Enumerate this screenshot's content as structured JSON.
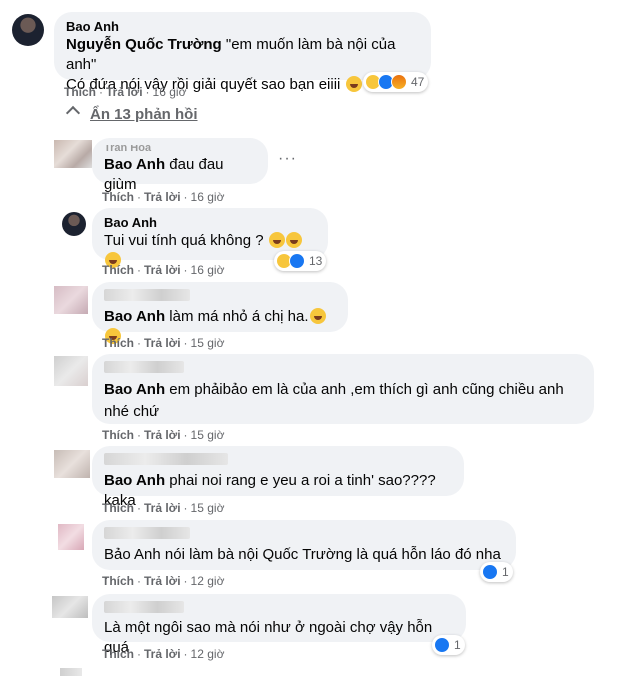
{
  "top_comment": {
    "author": "Bao Anh",
    "mention": "Nguyễn Quốc Trường",
    "line1_rest": " \"em muốn làm bà nội của anh\"",
    "line2": "Có đứa nói vậy rồi giải quyết sao bạn eiiii",
    "reaction_count": "47",
    "like": "Thích",
    "reply": "Trả lời",
    "time": "16 giờ"
  },
  "hide_replies": "Ẩn 13 phản hồi",
  "replies": [
    {
      "author": "Trần Hoà",
      "mention": "Bao Anh",
      "text": " đau đau giùm",
      "like": "Thích",
      "reply": "Trả lời",
      "time": "16 giờ"
    },
    {
      "author": "Bao Anh",
      "text": "Tui vui tính quá không ?",
      "reaction_count": "13",
      "like": "Thích",
      "reply": "Trả lời",
      "time": "16 giờ"
    },
    {
      "mention": "Bao Anh",
      "text": " làm má nhỏ á chị ha.",
      "like": "Thích",
      "reply": "Trả lời",
      "time": "15 giờ"
    },
    {
      "mention": "Bao Anh",
      "text": " em phảibảo em là của anh ,em thích gì anh cũng chiều anh nhé chứ",
      "like": "Thích",
      "reply": "Trả lời",
      "time": "15 giờ"
    },
    {
      "mention": "Bao Anh",
      "text": " phai noi rang e yeu a roi a tinh' sao????kaka",
      "like": "Thích",
      "reply": "Trả lời",
      "time": "15 giờ"
    },
    {
      "text": "Bảo Anh nói làm bà nội Quốc Trường là quá hỗn láo đó nha .",
      "reaction_count": "1",
      "like": "Thích",
      "reply": "Trả lời",
      "time": "12 giờ"
    },
    {
      "text": "Là một ngôi sao mà nói như ở ngoài chợ vậy hỗn quá",
      "reaction_count": "1",
      "like": "Thích",
      "reply": "Trả lời",
      "time": "12 giờ"
    }
  ],
  "colors": {
    "bubble": "#f0f2f5",
    "meta": "#65676b",
    "like_blue": "#1877f2",
    "haha_yellow": "#f7c63c"
  }
}
